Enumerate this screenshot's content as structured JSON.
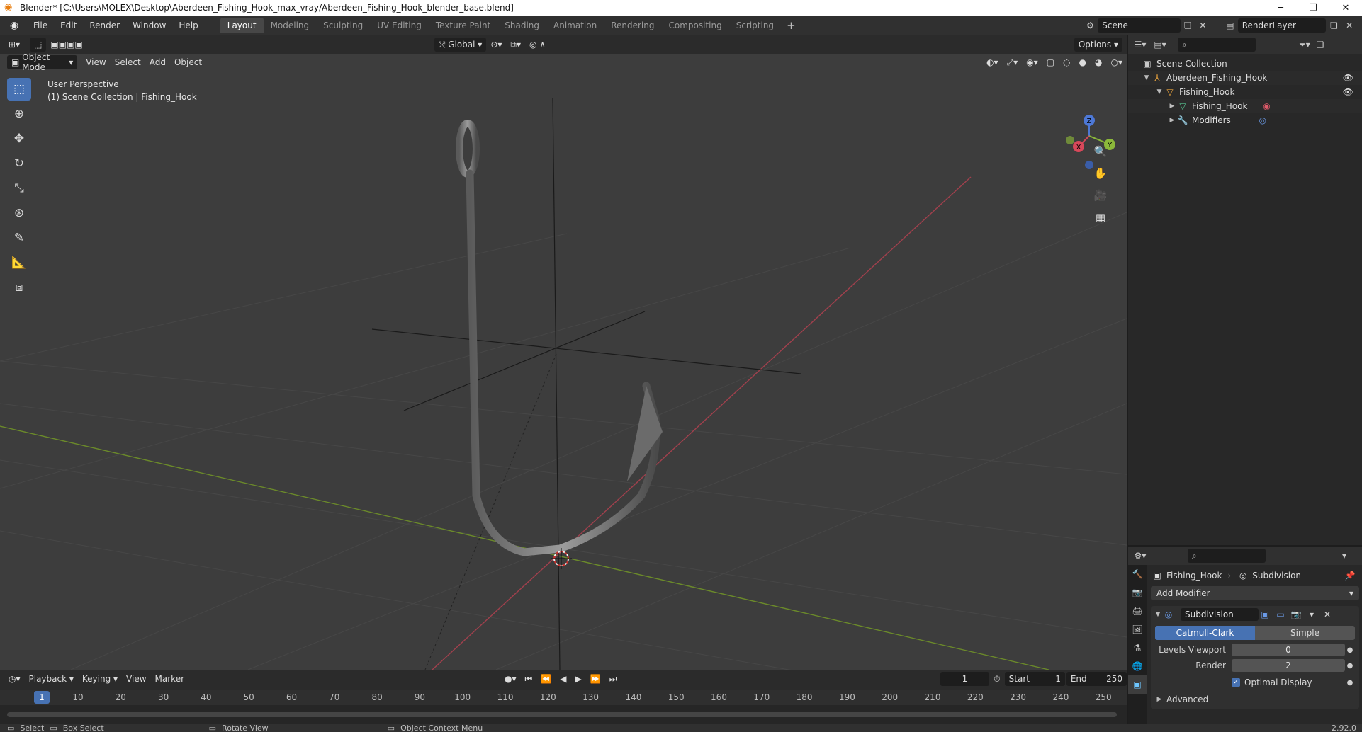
{
  "window": {
    "title": "Blender* [C:\\Users\\MOLEX\\Desktop\\Aberdeen_Fishing_Hook_max_vray/Aberdeen_Fishing_Hook_blender_base.blend]"
  },
  "menu": [
    "File",
    "Edit",
    "Render",
    "Window",
    "Help"
  ],
  "workspaces": [
    "Layout",
    "Modeling",
    "Sculpting",
    "UV Editing",
    "Texture Paint",
    "Shading",
    "Animation",
    "Rendering",
    "Compositing",
    "Scripting"
  ],
  "active_workspace": "Layout",
  "scene": {
    "name": "Scene",
    "layer": "RenderLayer"
  },
  "viewport": {
    "transform_orientation": "Global",
    "options_label": "Options",
    "mode": "Object Mode",
    "menus": [
      "View",
      "Select",
      "Add",
      "Object"
    ],
    "info_line1": "User Perspective",
    "info_line2": "(1) Scene Collection | Fishing_Hook",
    "gizmo_axes": {
      "x": "X",
      "y": "Y",
      "z": "Z"
    }
  },
  "outliner": {
    "rows": [
      {
        "label": "Scene Collection",
        "indent": 0,
        "icon": "collection-icon"
      },
      {
        "label": "Aberdeen_Fishing_Hook",
        "indent": 1,
        "icon": "armature-icon"
      },
      {
        "label": "Fishing_Hook",
        "indent": 2,
        "icon": "mesh-object-icon"
      },
      {
        "label": "Fishing_Hook",
        "indent": 3,
        "icon": "mesh-data-icon"
      },
      {
        "label": "Modifiers",
        "indent": 3,
        "icon": "wrench-icon"
      }
    ]
  },
  "properties": {
    "object": "Fishing_Hook",
    "modifier_tab": "Subdivision",
    "add_modifier": "Add Modifier",
    "modifier_name": "Subdivision",
    "type_options": [
      "Catmull-Clark",
      "Simple"
    ],
    "active_type": "Catmull-Clark",
    "levels_viewport_label": "Levels Viewport",
    "levels_viewport_value": "0",
    "render_label": "Render",
    "render_value": "2",
    "optimal_display_label": "Optimal Display",
    "advanced_label": "Advanced"
  },
  "timeline": {
    "menus": [
      "Playback",
      "Keying",
      "View",
      "Marker"
    ],
    "current_frame": "1",
    "start_label": "Start",
    "start_value": "1",
    "end_label": "End",
    "end_value": "250",
    "ruler": [
      "1",
      "10",
      "20",
      "30",
      "40",
      "50",
      "60",
      "70",
      "80",
      "90",
      "100",
      "110",
      "120",
      "130",
      "140",
      "150",
      "160",
      "170",
      "180",
      "190",
      "200",
      "210",
      "220",
      "230",
      "240",
      "250"
    ]
  },
  "status": {
    "select": "Select",
    "box_select": "Box Select",
    "rotate_view": "Rotate View",
    "context_menu": "Object Context Menu",
    "version": "2.92.0"
  }
}
